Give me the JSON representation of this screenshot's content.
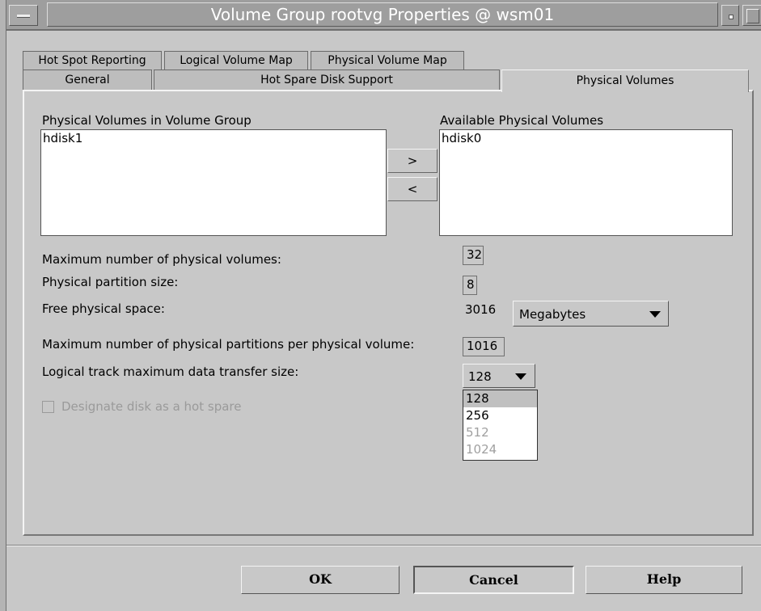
{
  "window": {
    "title": "Volume Group rootvg Properties @ wsm01"
  },
  "tabs": {
    "row1": [
      "Hot Spot Reporting",
      "Logical Volume Map",
      "Physical Volume Map"
    ],
    "row2": [
      "General",
      "Hot Spare Disk Support",
      "Physical Volumes"
    ],
    "active": "Physical Volumes"
  },
  "physical_volumes": {
    "in_group_label": "Physical Volumes in Volume Group",
    "in_group_items": [
      "hdisk1"
    ],
    "available_label": "Available Physical Volumes",
    "available_items": [
      "hdisk0"
    ],
    "add_label": ">",
    "remove_label": "<"
  },
  "properties": {
    "max_pv_label": "Maximum number of physical volumes:",
    "max_pv_value": "32",
    "pp_size_label": "Physical partition size:",
    "pp_size_value": "8",
    "free_space_label": "Free physical space:",
    "free_space_value": "3016",
    "free_space_unit": "Megabytes",
    "max_pp_label": "Maximum number of physical partitions per physical volume:",
    "max_pp_value": "1016",
    "ltg_label": "Logical track maximum data transfer size:",
    "ltg_value": "128",
    "ltg_options": [
      "128",
      "256",
      "512",
      "1024"
    ],
    "hot_spare_label": "Designate disk as a hot spare"
  },
  "buttons": {
    "ok": "OK",
    "cancel": "Cancel",
    "help": "Help"
  }
}
